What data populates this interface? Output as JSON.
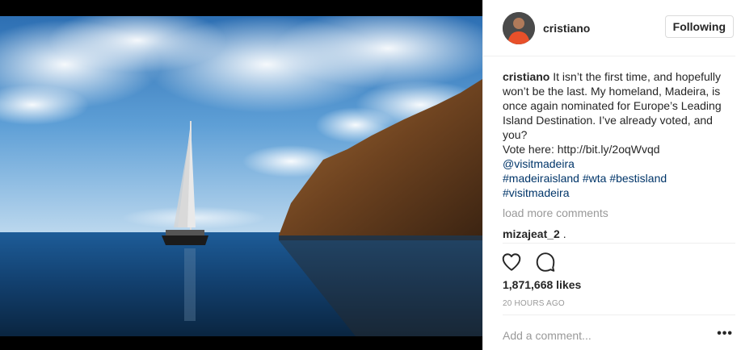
{
  "post": {
    "author": "cristiano",
    "follow_label": "Following",
    "caption": {
      "username": "cristiano",
      "text": " It isn’t the first time, and hopefully won’t be the last. My homeland, Madeira, is once again nominated for Europe’s Leading Island Destination. I’ve already voted, and you?",
      "vote_line": "Vote here: http://bit.ly/2oqWvqd",
      "mention": "@visitmadeira",
      "tag1": "#madeiraisland",
      "tag2": "#wta",
      "tag3": "#bestisland",
      "tag4": "#visitmadeira"
    },
    "load_more_label": "load more comments",
    "comment": {
      "username": "mizajeat_2",
      "text": " ."
    },
    "likes": "1,871,668 likes",
    "timestamp": "20 HOURS AGO",
    "add_comment_placeholder": "Add a comment...",
    "more_label": "•••"
  },
  "icons": {
    "like": "heart-icon",
    "comment": "comment-icon",
    "more": "more-options-icon"
  },
  "colors": {
    "link": "#003569",
    "muted": "#999999",
    "text": "#262626",
    "border": "#dbdbdb"
  }
}
